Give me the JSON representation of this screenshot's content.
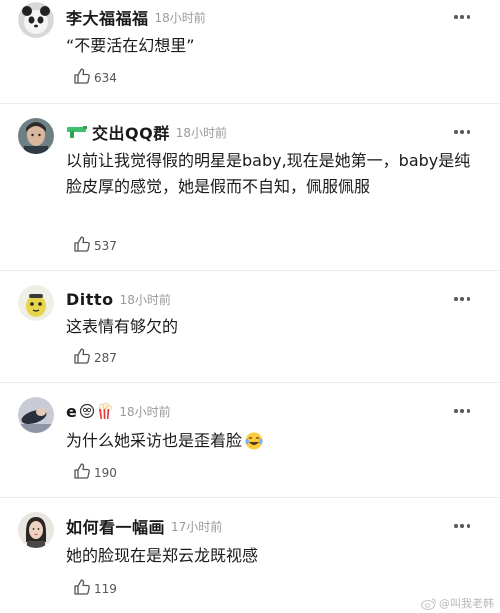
{
  "comments": [
    {
      "username": "李大福福福",
      "time": "18小时前",
      "text": "“不要活在幻想里”",
      "likes": "634",
      "avatar_icon": "panda-avatar-icon"
    },
    {
      "username": "交出QQ群",
      "time": "18小时前",
      "text": "以前让我觉得假的明星是baby,现在是她第一，baby是纯脸皮厚的感觉，她是假而不自知，佩服佩服",
      "likes": "537",
      "badge_icon": "water-gun-icon",
      "avatar_icon": "person-avatar-icon"
    },
    {
      "username": "Ditto",
      "time": "18小时前",
      "text": "这表情有够欠的",
      "likes": "287",
      "avatar_icon": "yellow-cartoon-avatar-icon"
    },
    {
      "username": "e",
      "time": "18小时前",
      "text": "为什么她采访也是歪着脸",
      "likes": "190",
      "name_icons": [
        "smiley-face-icon",
        "popcorn-icon"
      ],
      "text_emoji": "laughing-tears-emoji-icon",
      "avatar_icon": "person-lying-avatar-icon"
    },
    {
      "username": "如何看一幅画",
      "time": "17小时前",
      "text": "她的脸现在是郑云龙既视感",
      "likes": "119",
      "avatar_icon": "portrait-avatar-icon"
    }
  ],
  "watermark": {
    "text": "@叫我老韩",
    "icon": "weibo-logo-icon"
  },
  "colors": {
    "text": "#1a1a1a",
    "meta": "#9a9a9a",
    "divider": "#ececec"
  }
}
